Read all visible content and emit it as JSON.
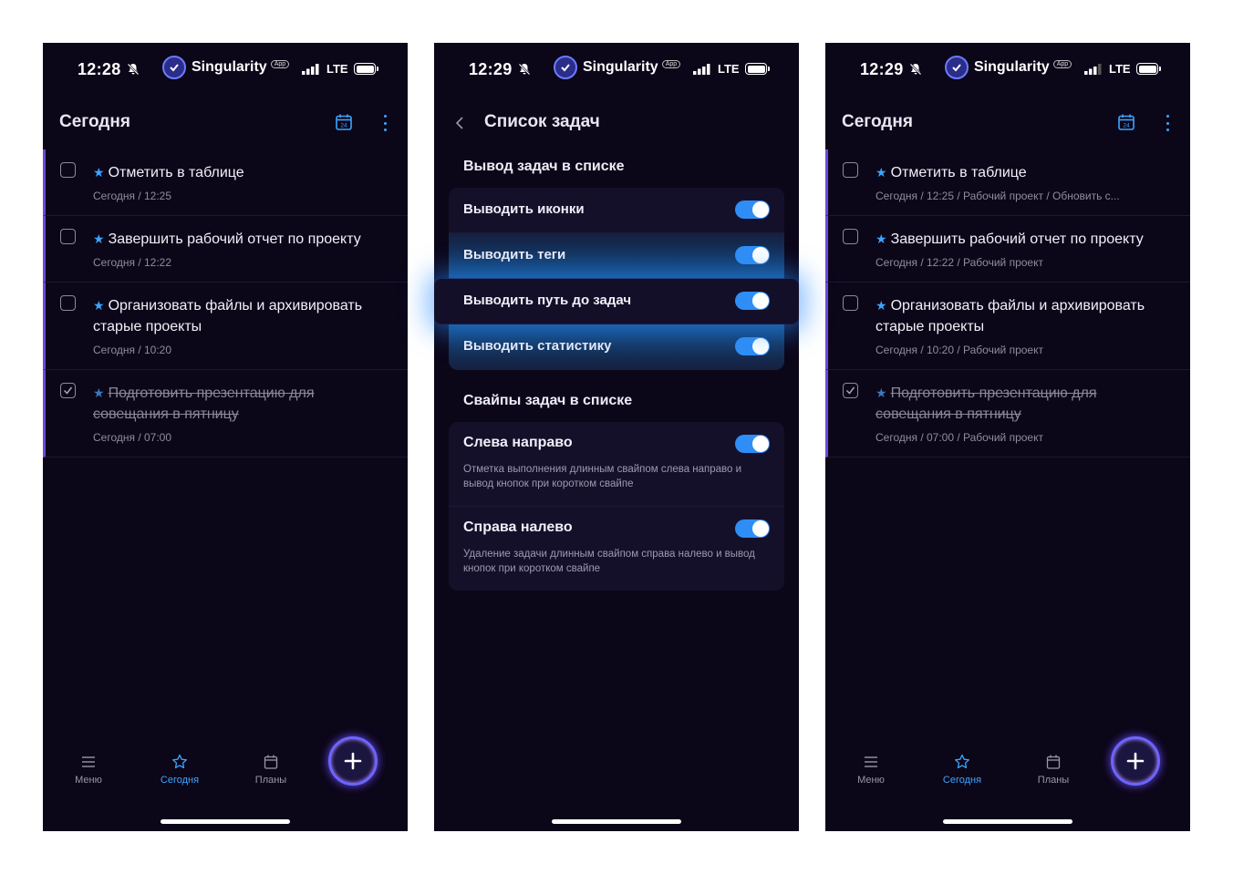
{
  "status": {
    "app_name": "Singularity",
    "app_tag": "App",
    "network": "LTE",
    "times": [
      "12:28",
      "12:29",
      "12:29"
    ]
  },
  "today": {
    "title": "Сегодня",
    "tasks_basic": [
      {
        "title": "Отметить в таблице",
        "meta": "Сегодня / 12:25",
        "done": false
      },
      {
        "title": "Завершить рабочий отчет по проекту",
        "meta": "Сегодня / 12:22",
        "done": false
      },
      {
        "title": "Организовать файлы и архивировать старые проекты",
        "meta": "Сегодня / 10:20",
        "done": false
      },
      {
        "title": "Подготовить презентацию для совещания в пятницу",
        "meta": "Сегодня / 07:00",
        "done": true
      }
    ],
    "tasks_with_path": [
      {
        "title": "Отметить в таблице",
        "meta": "Сегодня / 12:25 / Рабочий проект / Обновить с...",
        "done": false
      },
      {
        "title": "Завершить рабочий отчет по проекту",
        "meta": "Сегодня / 12:22 / Рабочий проект",
        "done": false
      },
      {
        "title": "Организовать файлы и архивировать старые проекты",
        "meta": "Сегодня / 10:20 / Рабочий проект",
        "done": false
      },
      {
        "title": "Подготовить презентацию для совещания в пятницу",
        "meta": "Сегодня / 07:00 / Рабочий проект",
        "done": true
      }
    ]
  },
  "nav": {
    "menu": "Меню",
    "today": "Сегодня",
    "plans": "Планы"
  },
  "settings": {
    "title": "Список задач",
    "section_output": "Вывод задач в списке",
    "show_icons": "Выводить иконки",
    "show_tags": "Выводить теги",
    "show_path": "Выводить путь до задач",
    "show_stats": "Выводить статистику",
    "section_swipes": "Свайпы задач в списке",
    "swipe_lr_label": "Слева направо",
    "swipe_lr_desc": "Отметка выполнения длинным свайпом слева направо и вывод кнопок при коротком свайпе",
    "swipe_rl_label": "Справа налево",
    "swipe_rl_desc": "Удаление задачи длинным свайпом справа налево и вывод кнопок при коротком свайпе",
    "toggles_on": [
      true,
      true,
      true,
      true,
      true,
      true
    ]
  },
  "colors": {
    "accent": "#3ba5ff",
    "background": "#0c0619",
    "task_stripe": "#6d49d8"
  }
}
